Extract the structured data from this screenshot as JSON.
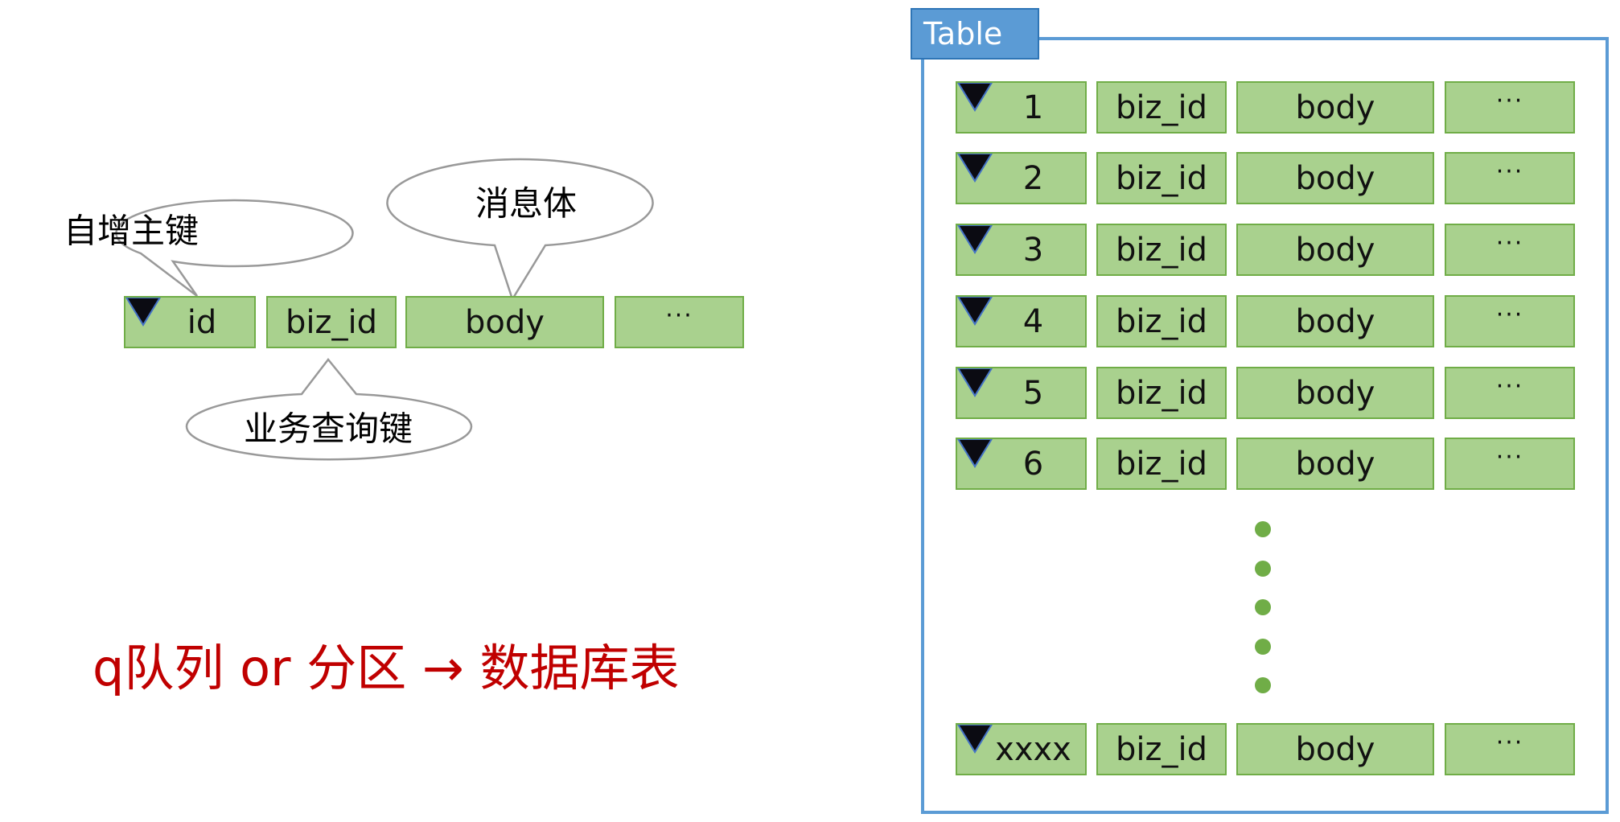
{
  "left": {
    "callout_id": "自增主键",
    "callout_body": "消息体",
    "callout_biz": "业务查询键",
    "row": [
      "id",
      "biz_id",
      "body",
      "···"
    ]
  },
  "caption": "q队列 or 分区 → 数据库表",
  "table": {
    "title": "Table",
    "rows": [
      {
        "id": "1",
        "biz": "biz_id",
        "body": "body",
        "more": "···"
      },
      {
        "id": "2",
        "biz": "biz_id",
        "body": "body",
        "more": "···"
      },
      {
        "id": "3",
        "biz": "biz_id",
        "body": "body",
        "more": "···"
      },
      {
        "id": "4",
        "biz": "biz_id",
        "body": "body",
        "more": "···"
      },
      {
        "id": "5",
        "biz": "biz_id",
        "body": "body",
        "more": "···"
      },
      {
        "id": "6",
        "biz": "biz_id",
        "body": "body",
        "more": "···"
      }
    ],
    "last_row": {
      "id": "xxxx",
      "biz": "biz_id",
      "body": "body",
      "more": "···"
    },
    "ellipsis_dot_count": 5
  },
  "colors": {
    "cell_fill": "#a9d18e",
    "cell_border": "#70ad47",
    "table_border": "#5b9bd5",
    "caption": "#c00000"
  }
}
